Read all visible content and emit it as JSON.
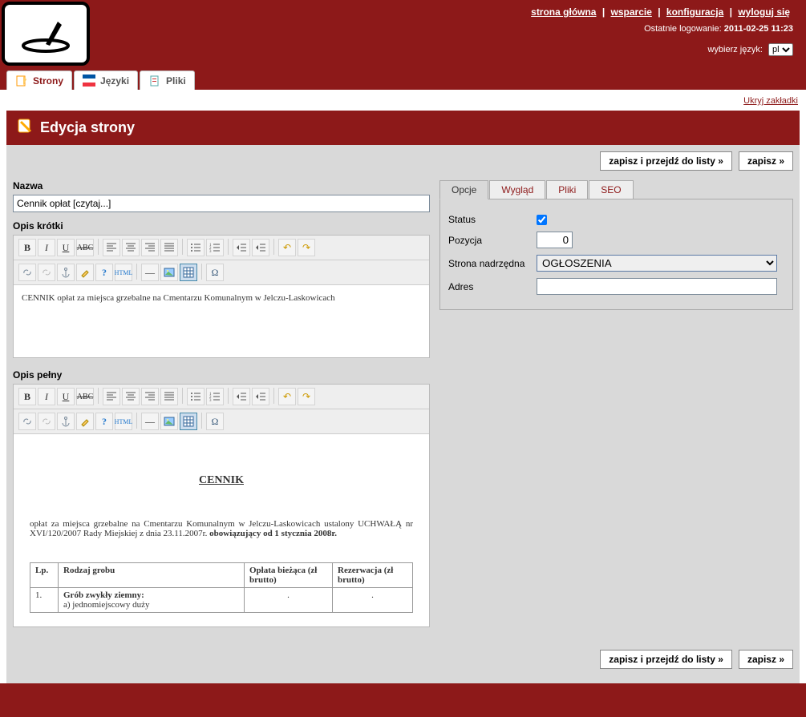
{
  "header": {
    "links": [
      "strona główna",
      "wsparcie",
      "konfiguracja",
      "wyloguj się"
    ],
    "last_login_label": "Ostatnie logowanie:",
    "last_login_value": "2011-02-25 11:23",
    "lang_label": "wybierz język:",
    "lang_value": "pl"
  },
  "main_tabs": [
    {
      "label": "Strony",
      "active": true
    },
    {
      "label": "Języki",
      "active": false
    },
    {
      "label": "Pliki",
      "active": false
    }
  ],
  "hide_tabs": "Ukryj zakładki",
  "page_title": "Edycja strony",
  "buttons": {
    "save_go": "zapisz i przejdź do listy »",
    "save": "zapisz »"
  },
  "form": {
    "name_label": "Nazwa",
    "name_value": "Cennik opłat [czytaj...]",
    "short_label": "Opis krótki",
    "short_content": "CENNIK opłat za miejsca grzebalne na Cmentarzu Komunalnym w Jelczu-Laskowicach",
    "full_label": "Opis pełny",
    "full": {
      "title": "CENNIK",
      "para": "opłat za miejsca grzebalne na Cmentarzu Komunalnym w Jelczu-Laskowicach ustalony UCHWAŁĄ nr XVI/120/2007 Rady Miejskiej z dnia 23.11.2007r.",
      "bold": "obowiązujący od 1 stycznia 2008r.",
      "table": {
        "headers": [
          "Lp.",
          "Rodzaj grobu",
          "Opłata bieżąca (zł brutto)",
          "Rezerwacja (zł brutto)"
        ],
        "row": [
          "1.",
          "Grób zwykły ziemny:",
          ".",
          "."
        ],
        "rowb": "a) jednomiejscowy duży"
      }
    }
  },
  "options": {
    "tabs": [
      "Opcje",
      "Wygląd",
      "Pliki",
      "SEO"
    ],
    "status_label": "Status",
    "status_checked": true,
    "position_label": "Pozycja",
    "position_value": "0",
    "parent_label": "Strona nadrzędna",
    "parent_value": "OGŁOSZENIA",
    "address_label": "Adres",
    "address_value": ""
  }
}
